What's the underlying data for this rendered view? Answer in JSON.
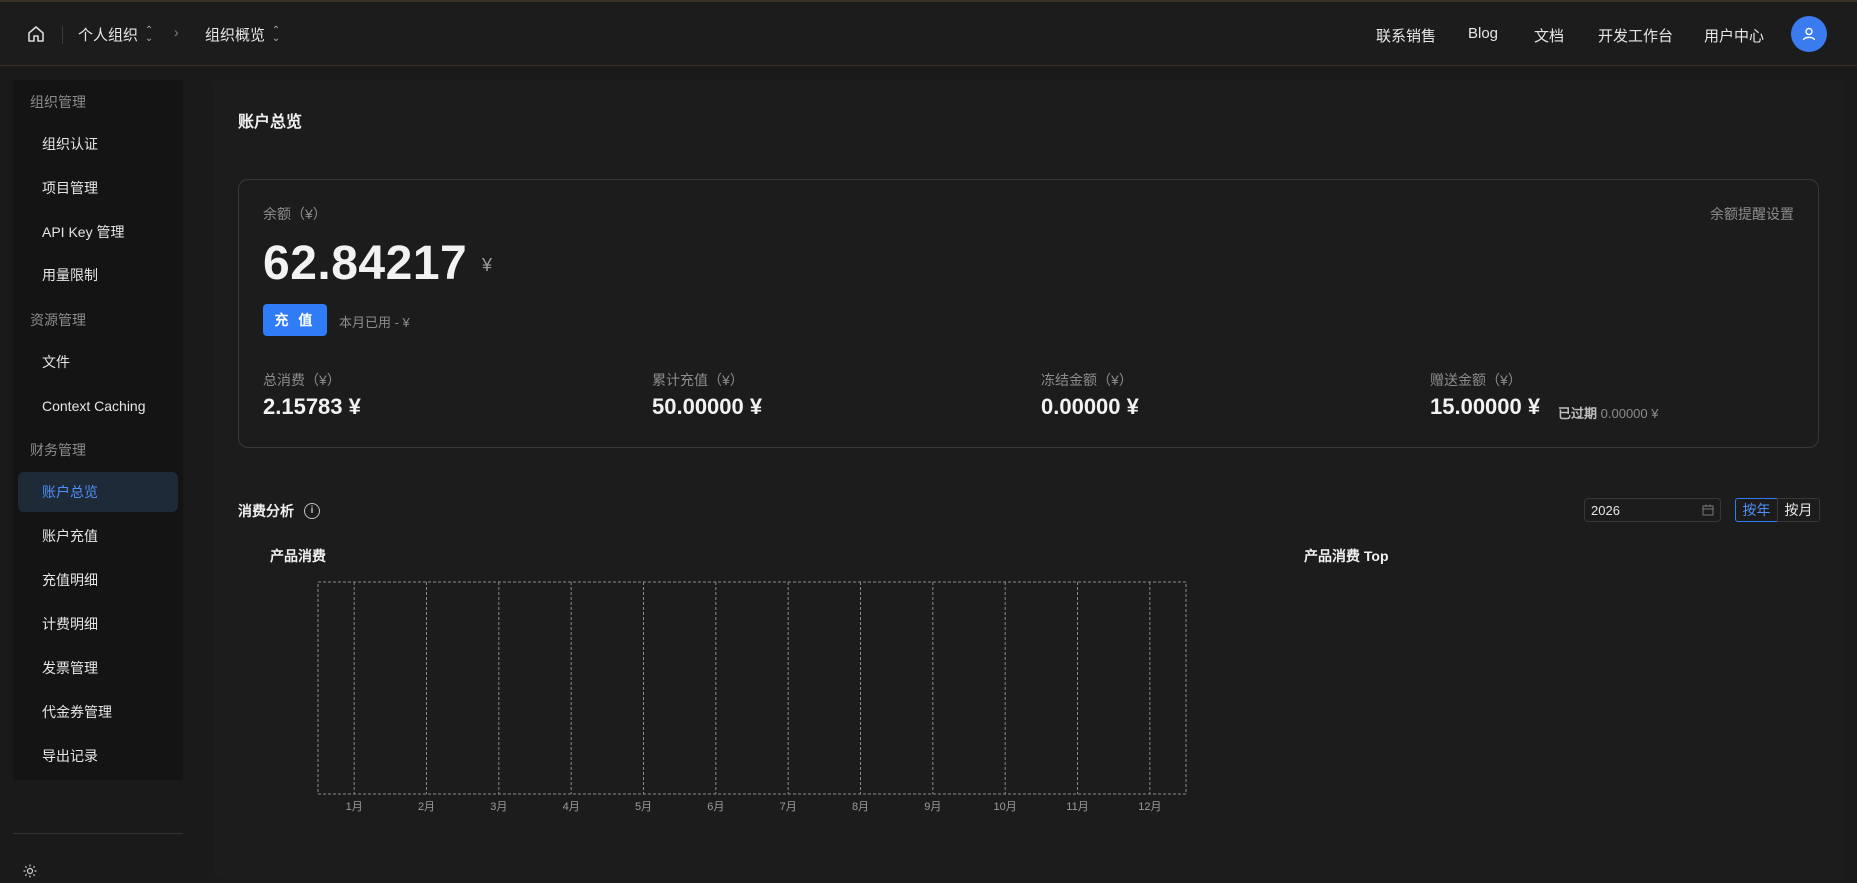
{
  "topbar": {
    "breadcrumb": [
      {
        "label": "个人组织"
      },
      {
        "label": "组织概览"
      }
    ],
    "links": [
      "联系销售",
      "Blog",
      "文档",
      "开发工作台",
      "用户中心"
    ]
  },
  "sidebar": {
    "groups": [
      {
        "title": "组织管理",
        "items": [
          "组织认证",
          "项目管理",
          "API Key 管理",
          "用量限制"
        ]
      },
      {
        "title": "资源管理",
        "items": [
          "文件",
          "Context Caching"
        ]
      },
      {
        "title": "财务管理",
        "items": [
          "账户总览",
          "账户充值",
          "充值明细",
          "计费明细",
          "发票管理",
          "代金券管理",
          "导出记录"
        ]
      }
    ],
    "active_item": "账户总览"
  },
  "main": {
    "title": "账户总览",
    "balance_label": "余额（¥）",
    "balance_alert_link": "余额提醒设置",
    "balance_value": "62.84217",
    "balance_unit": "¥",
    "recharge_button": "充 值",
    "month_used": "本月已用 - ¥",
    "stats": [
      {
        "label": "总消费（¥）",
        "value": "2.15783 ¥"
      },
      {
        "label": "累计充值（¥）",
        "value": "50.00000 ¥"
      },
      {
        "label": "冻结金额（¥）",
        "value": "0.00000 ¥"
      },
      {
        "label": "赠送金额（¥）",
        "value": "15.00000 ¥"
      }
    ],
    "expired_label": "已过期",
    "expired_value": "0.00000 ¥",
    "analysis_title": "消费分析",
    "year_value": "2026",
    "segment_year": "按年",
    "segment_month": "按月",
    "product_chart_title": "产品消费",
    "top_chart_title": "产品消费 Top"
  },
  "chart_data": {
    "type": "bar",
    "title": "产品消费",
    "categories": [
      "1月",
      "2月",
      "3月",
      "4月",
      "5月",
      "6月",
      "7月",
      "8月",
      "9月",
      "10月",
      "11月",
      "12月"
    ],
    "series": [],
    "grid": true
  },
  "colors": {
    "accent": "#2f7cf6",
    "background": "#1a1a1a",
    "panel": "#1c1c1c",
    "active_nav_bg": "#1e2a38"
  }
}
